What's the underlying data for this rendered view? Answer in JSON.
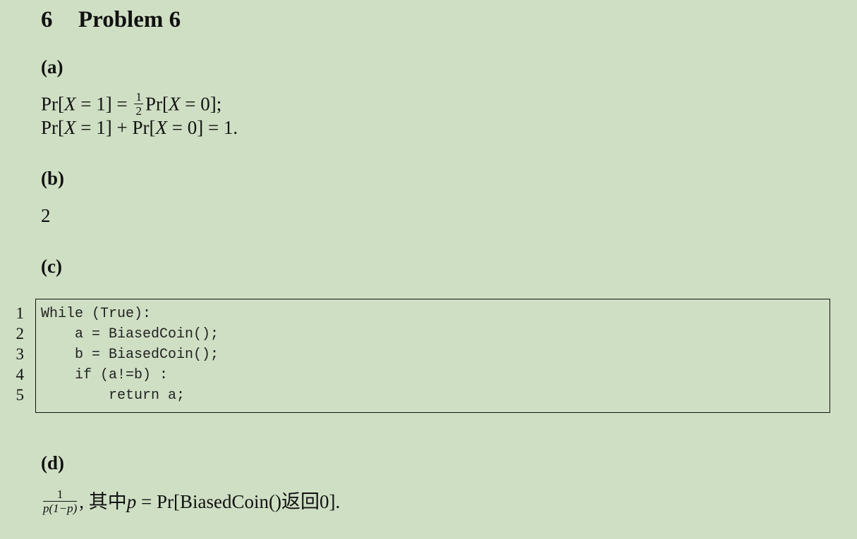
{
  "section": {
    "number": "6",
    "title": "Problem 6"
  },
  "parts": {
    "a": {
      "label": "(a)"
    },
    "b": {
      "label": "(b)",
      "answer": "2"
    },
    "c": {
      "label": "(c)"
    },
    "d": {
      "label": "(d)"
    }
  },
  "math": {
    "pr": "Pr",
    "x_var": "X",
    "eq1_lhs_tail": " = 1] = ",
    "half_num": "1",
    "half_den": "2",
    "eq1_rhs_tail": " = 0];",
    "eq2_mid": " = 1] + ",
    "eq2_tail": " = 0] = 1.",
    "d_frac_num": "1",
    "d_frac_den": "p(1−p)",
    "d_text_1": ", 其中",
    "d_p": "p",
    "d_text_2": " = Pr[BiasedCoin()返回0]."
  },
  "code": {
    "line_numbers": [
      "1",
      "2",
      "3",
      "4",
      "5"
    ],
    "lines": [
      "While (True):",
      "    a = BiasedCoin();",
      "    b = BiasedCoin();",
      "    if (a!=b) :",
      "        return a;"
    ]
  }
}
